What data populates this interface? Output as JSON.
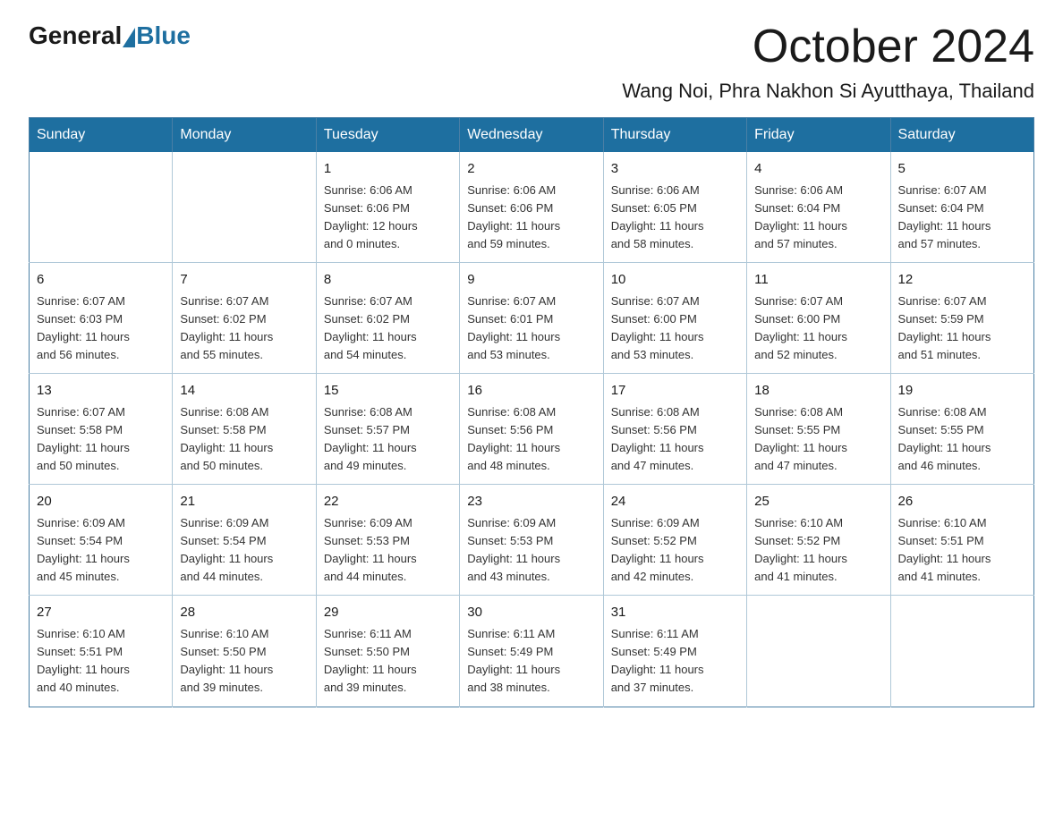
{
  "logo": {
    "general": "General",
    "blue": "Blue"
  },
  "header": {
    "month_title": "October 2024",
    "location": "Wang Noi, Phra Nakhon Si Ayutthaya, Thailand"
  },
  "weekdays": [
    "Sunday",
    "Monday",
    "Tuesday",
    "Wednesday",
    "Thursday",
    "Friday",
    "Saturday"
  ],
  "weeks": [
    [
      {
        "day": "",
        "info": ""
      },
      {
        "day": "",
        "info": ""
      },
      {
        "day": "1",
        "info": "Sunrise: 6:06 AM\nSunset: 6:06 PM\nDaylight: 12 hours\nand 0 minutes."
      },
      {
        "day": "2",
        "info": "Sunrise: 6:06 AM\nSunset: 6:06 PM\nDaylight: 11 hours\nand 59 minutes."
      },
      {
        "day": "3",
        "info": "Sunrise: 6:06 AM\nSunset: 6:05 PM\nDaylight: 11 hours\nand 58 minutes."
      },
      {
        "day": "4",
        "info": "Sunrise: 6:06 AM\nSunset: 6:04 PM\nDaylight: 11 hours\nand 57 minutes."
      },
      {
        "day": "5",
        "info": "Sunrise: 6:07 AM\nSunset: 6:04 PM\nDaylight: 11 hours\nand 57 minutes."
      }
    ],
    [
      {
        "day": "6",
        "info": "Sunrise: 6:07 AM\nSunset: 6:03 PM\nDaylight: 11 hours\nand 56 minutes."
      },
      {
        "day": "7",
        "info": "Sunrise: 6:07 AM\nSunset: 6:02 PM\nDaylight: 11 hours\nand 55 minutes."
      },
      {
        "day": "8",
        "info": "Sunrise: 6:07 AM\nSunset: 6:02 PM\nDaylight: 11 hours\nand 54 minutes."
      },
      {
        "day": "9",
        "info": "Sunrise: 6:07 AM\nSunset: 6:01 PM\nDaylight: 11 hours\nand 53 minutes."
      },
      {
        "day": "10",
        "info": "Sunrise: 6:07 AM\nSunset: 6:00 PM\nDaylight: 11 hours\nand 53 minutes."
      },
      {
        "day": "11",
        "info": "Sunrise: 6:07 AM\nSunset: 6:00 PM\nDaylight: 11 hours\nand 52 minutes."
      },
      {
        "day": "12",
        "info": "Sunrise: 6:07 AM\nSunset: 5:59 PM\nDaylight: 11 hours\nand 51 minutes."
      }
    ],
    [
      {
        "day": "13",
        "info": "Sunrise: 6:07 AM\nSunset: 5:58 PM\nDaylight: 11 hours\nand 50 minutes."
      },
      {
        "day": "14",
        "info": "Sunrise: 6:08 AM\nSunset: 5:58 PM\nDaylight: 11 hours\nand 50 minutes."
      },
      {
        "day": "15",
        "info": "Sunrise: 6:08 AM\nSunset: 5:57 PM\nDaylight: 11 hours\nand 49 minutes."
      },
      {
        "day": "16",
        "info": "Sunrise: 6:08 AM\nSunset: 5:56 PM\nDaylight: 11 hours\nand 48 minutes."
      },
      {
        "day": "17",
        "info": "Sunrise: 6:08 AM\nSunset: 5:56 PM\nDaylight: 11 hours\nand 47 minutes."
      },
      {
        "day": "18",
        "info": "Sunrise: 6:08 AM\nSunset: 5:55 PM\nDaylight: 11 hours\nand 47 minutes."
      },
      {
        "day": "19",
        "info": "Sunrise: 6:08 AM\nSunset: 5:55 PM\nDaylight: 11 hours\nand 46 minutes."
      }
    ],
    [
      {
        "day": "20",
        "info": "Sunrise: 6:09 AM\nSunset: 5:54 PM\nDaylight: 11 hours\nand 45 minutes."
      },
      {
        "day": "21",
        "info": "Sunrise: 6:09 AM\nSunset: 5:54 PM\nDaylight: 11 hours\nand 44 minutes."
      },
      {
        "day": "22",
        "info": "Sunrise: 6:09 AM\nSunset: 5:53 PM\nDaylight: 11 hours\nand 44 minutes."
      },
      {
        "day": "23",
        "info": "Sunrise: 6:09 AM\nSunset: 5:53 PM\nDaylight: 11 hours\nand 43 minutes."
      },
      {
        "day": "24",
        "info": "Sunrise: 6:09 AM\nSunset: 5:52 PM\nDaylight: 11 hours\nand 42 minutes."
      },
      {
        "day": "25",
        "info": "Sunrise: 6:10 AM\nSunset: 5:52 PM\nDaylight: 11 hours\nand 41 minutes."
      },
      {
        "day": "26",
        "info": "Sunrise: 6:10 AM\nSunset: 5:51 PM\nDaylight: 11 hours\nand 41 minutes."
      }
    ],
    [
      {
        "day": "27",
        "info": "Sunrise: 6:10 AM\nSunset: 5:51 PM\nDaylight: 11 hours\nand 40 minutes."
      },
      {
        "day": "28",
        "info": "Sunrise: 6:10 AM\nSunset: 5:50 PM\nDaylight: 11 hours\nand 39 minutes."
      },
      {
        "day": "29",
        "info": "Sunrise: 6:11 AM\nSunset: 5:50 PM\nDaylight: 11 hours\nand 39 minutes."
      },
      {
        "day": "30",
        "info": "Sunrise: 6:11 AM\nSunset: 5:49 PM\nDaylight: 11 hours\nand 38 minutes."
      },
      {
        "day": "31",
        "info": "Sunrise: 6:11 AM\nSunset: 5:49 PM\nDaylight: 11 hours\nand 37 minutes."
      },
      {
        "day": "",
        "info": ""
      },
      {
        "day": "",
        "info": ""
      }
    ]
  ]
}
